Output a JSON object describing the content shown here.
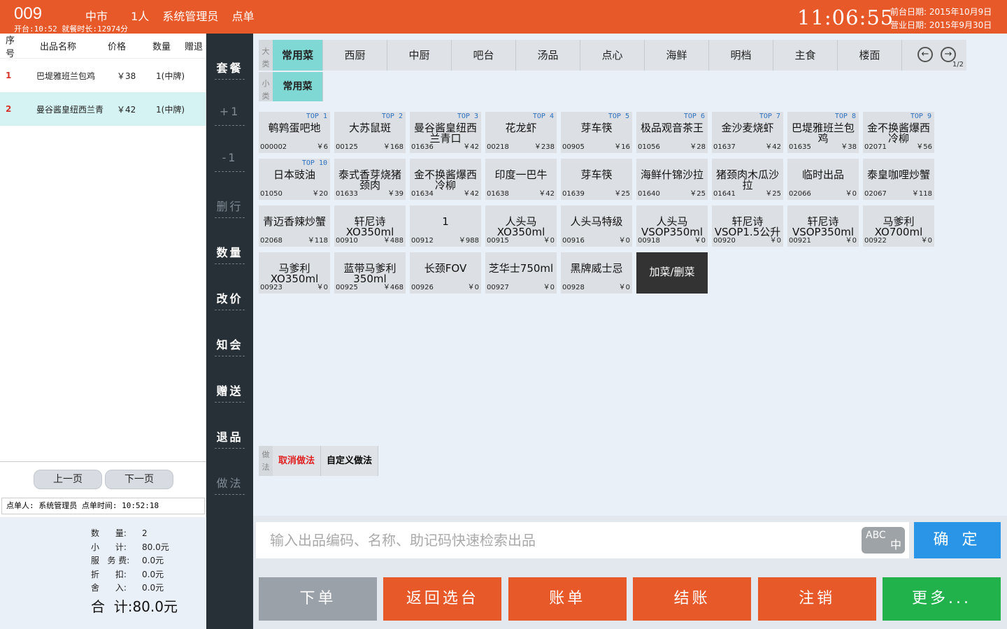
{
  "header": {
    "table_no": "009",
    "area": "中市",
    "guests": "1人",
    "user": "系统管理员",
    "mode": "点单",
    "open_info": "开台:10:52 就餐时长:12974分",
    "clock": "11:06:55",
    "front_date": "前台日期: 2015年10月9日",
    "biz_date": "营业日期: 2015年9月30日"
  },
  "order": {
    "columns": [
      "序号",
      "出品名称",
      "价格",
      "数量",
      "赠退"
    ],
    "rows": [
      {
        "no": "1",
        "name": "巴堤雅班兰包鸡",
        "price": "￥38",
        "qty": "1(中牌)",
        "selected": false
      },
      {
        "no": "2",
        "name": "曼谷酱皇纽西兰青",
        "price": "￥42",
        "qty": "1(中牌)",
        "selected": true
      }
    ],
    "prev": "上一页",
    "next": "下一页",
    "orderer": "点单人: 系统管理员  点单时间: 10:52:18"
  },
  "summary": {
    "rows": [
      {
        "label": "数      量:",
        "value": "2"
      },
      {
        "label": "小      计:",
        "value": "80.0元"
      },
      {
        "label": "服   务 费:",
        "value": "0.0元"
      },
      {
        "label": "折      扣:",
        "value": "0.0元"
      },
      {
        "label": "舍      入:",
        "value": "0.0元"
      }
    ],
    "total_label": "合  计:",
    "total_value": "80.0元"
  },
  "side_buttons": [
    {
      "label": "套餐",
      "dim": false
    },
    {
      "label": "+1",
      "dim": true
    },
    {
      "label": "-1",
      "dim": true
    },
    {
      "label": "删行",
      "dim": true
    },
    {
      "label": "数量",
      "dim": false
    },
    {
      "label": "改价",
      "dim": false
    },
    {
      "label": "知会",
      "dim": false
    },
    {
      "label": "赠送",
      "dim": false
    },
    {
      "label": "退品",
      "dim": false
    },
    {
      "label": "做法",
      "dim": true
    }
  ],
  "categories": {
    "big_tag": "大类",
    "small_tag": "小类",
    "big": [
      "常用菜",
      "西厨",
      "中厨",
      "吧台",
      "汤品",
      "点心",
      "海鲜",
      "明档",
      "主食",
      "楼面"
    ],
    "small": [
      "常用菜"
    ],
    "page": "1/2"
  },
  "items": [
    {
      "top": "TOP 1",
      "name": "鹌鹑蛋吧地",
      "code": "000002",
      "price": "￥6"
    },
    {
      "top": "TOP 2",
      "name": "大苏鼠斑",
      "code": "00125",
      "price": "￥168"
    },
    {
      "top": "TOP 3",
      "name": "曼谷酱皇纽西兰青口",
      "code": "01636",
      "price": "￥42"
    },
    {
      "top": "TOP 4",
      "name": "花龙虾",
      "code": "00218",
      "price": "￥238"
    },
    {
      "top": "TOP 5",
      "name": "芽车筷",
      "code": "00905",
      "price": "￥16"
    },
    {
      "top": "TOP 6",
      "name": "极品观音茶王",
      "code": "01056",
      "price": "￥28"
    },
    {
      "top": "TOP 7",
      "name": "金沙麦烧虾",
      "code": "01637",
      "price": "￥42"
    },
    {
      "top": "TOP 8",
      "name": "巴堤雅班兰包鸡",
      "code": "01635",
      "price": "￥38"
    },
    {
      "top": "TOP 9",
      "name": "金不换酱爆西冷柳",
      "code": "02071",
      "price": "￥56"
    },
    {
      "top": "TOP 10",
      "name": "日本豉油",
      "code": "01050",
      "price": "￥20"
    },
    {
      "top": "",
      "name": "泰式香芽烧猪颈肉",
      "code": "01633",
      "price": "￥39"
    },
    {
      "top": "",
      "name": "金不换酱爆西冷柳",
      "code": "01634",
      "price": "￥42"
    },
    {
      "top": "",
      "name": "印度一巴牛",
      "code": "01638",
      "price": "￥42"
    },
    {
      "top": "",
      "name": "芽车筷",
      "code": "01639",
      "price": "￥25"
    },
    {
      "top": "",
      "name": "海鲜什锦沙拉",
      "code": "01640",
      "price": "￥25"
    },
    {
      "top": "",
      "name": "猪颈肉木瓜沙拉",
      "code": "01641",
      "price": "￥25"
    },
    {
      "top": "",
      "name": "临时出品",
      "code": "02066",
      "price": "￥0"
    },
    {
      "top": "",
      "name": "泰皇咖哩炒蟹",
      "code": "02067",
      "price": "￥118"
    },
    {
      "top": "",
      "name": "青迈香辣炒蟹",
      "code": "02068",
      "price": "￥118"
    },
    {
      "top": "",
      "name": "轩尼诗XO350ml",
      "code": "00910",
      "price": "￥488"
    },
    {
      "top": "",
      "name": "1",
      "code": "00912",
      "price": "￥988"
    },
    {
      "top": "",
      "name": "人头马XO350ml",
      "code": "00915",
      "price": "￥0"
    },
    {
      "top": "",
      "name": "人头马特级",
      "code": "00916",
      "price": "￥0"
    },
    {
      "top": "",
      "name": "人头马VSOP350ml",
      "code": "00918",
      "price": "￥0"
    },
    {
      "top": "",
      "name": "轩尼诗VSOP1.5公升",
      "code": "00920",
      "price": "￥0"
    },
    {
      "top": "",
      "name": "轩尼诗VSOP350ml",
      "code": "00921",
      "price": "￥0"
    },
    {
      "top": "",
      "name": "马爹利XO700ml",
      "code": "00922",
      "price": "￥0"
    },
    {
      "top": "",
      "name": "马爹利XO350ml",
      "code": "00923",
      "price": "￥0"
    },
    {
      "top": "",
      "name": "蓝带马爹利350ml",
      "code": "00925",
      "price": "￥468"
    },
    {
      "top": "",
      "name": "长颈FOV",
      "code": "00926",
      "price": "￥0"
    },
    {
      "top": "",
      "name": "芝华士750ml",
      "code": "00927",
      "price": "￥0"
    },
    {
      "top": "",
      "name": "黑牌威士忌",
      "code": "00928",
      "price": "￥0"
    }
  ],
  "add_item": "加菜/删菜",
  "methods": {
    "tag": "做法",
    "cancel": "取消做法",
    "custom": "自定义做法"
  },
  "search": {
    "placeholder": "输入出品编码、名称、助记码快速检索出品",
    "ime_top": "ABC",
    "ime_bottom": "中",
    "confirm": "确 定"
  },
  "actions": [
    {
      "label": "下单",
      "color": "#9ba1a8"
    },
    {
      "label": "返回选台",
      "color": "#e8592a"
    },
    {
      "label": "账单",
      "color": "#e8592a"
    },
    {
      "label": "结账",
      "color": "#e8592a"
    },
    {
      "label": "注销",
      "color": "#e8592a"
    },
    {
      "label": "更多...",
      "color": "#22b24c"
    }
  ]
}
